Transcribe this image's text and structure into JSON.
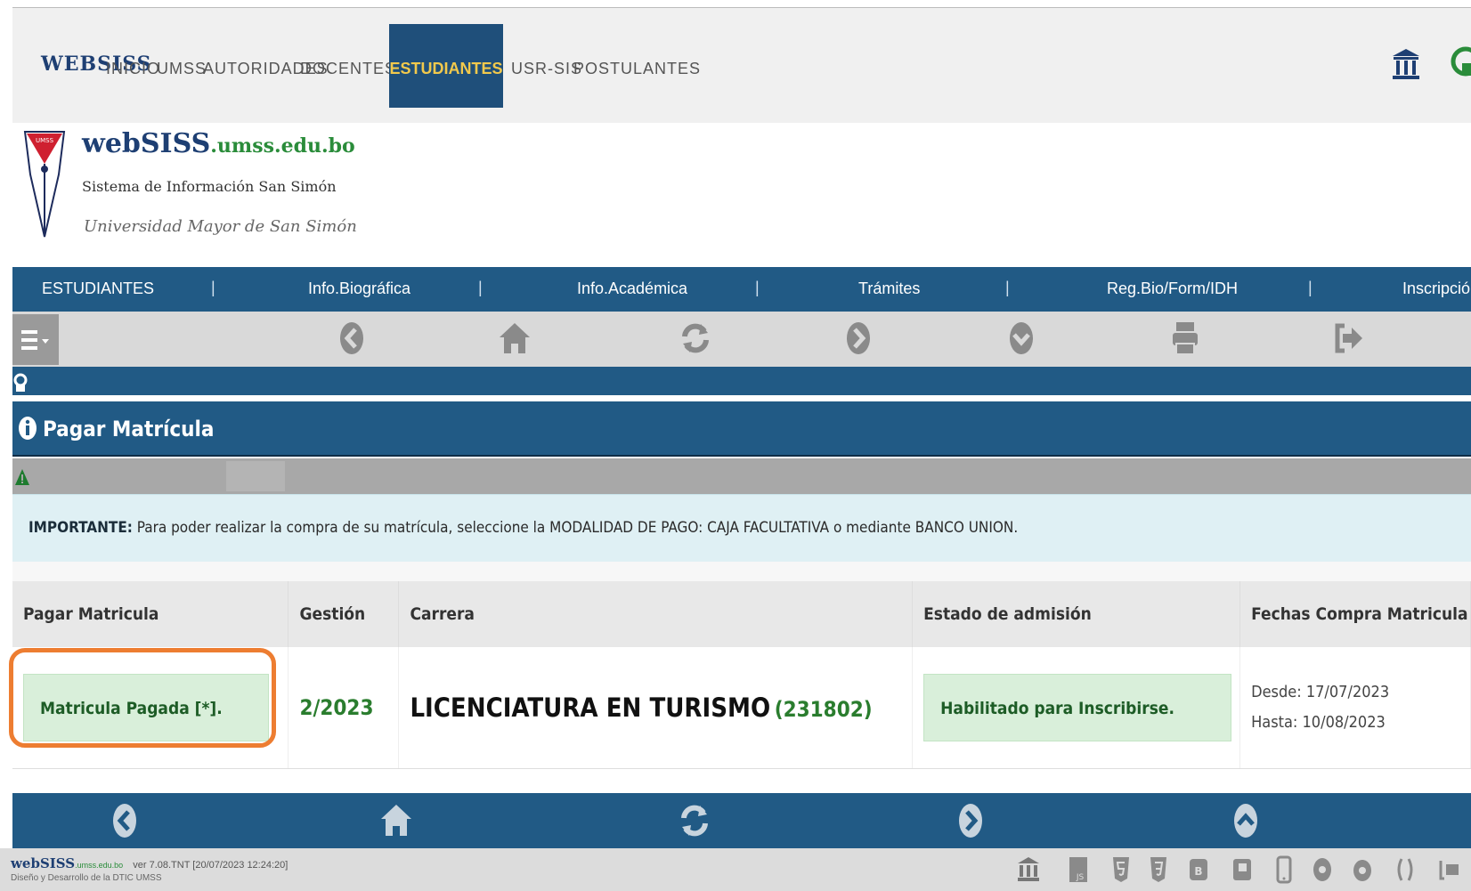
{
  "top_nav": {
    "brand": "WEBSISS",
    "tabs": [
      "INICIO",
      "UMSS",
      "AUTORIDADES",
      "DOCENTES",
      "ESTUDIANTES",
      "USR-SIS",
      "POSTULANTES"
    ],
    "active_tab": "ESTUDIANTES"
  },
  "banner": {
    "site_name": "webSISS",
    "site_domain": ".umss.edu.bo",
    "subtitle": "Sistema de Información San Simón",
    "university": "Universidad Mayor de San Simón",
    "shield_text": "UMSS"
  },
  "main_nav": {
    "items": [
      "ESTUDIANTES",
      "Info.Biográfica",
      "Info.Académica",
      "Trámites",
      "Reg.Bio/Form/IDH",
      "Inscripción"
    ],
    "separator": "|"
  },
  "toolbar": {
    "icons": [
      "menu-icon",
      "back-icon",
      "home-icon",
      "refresh-icon",
      "forward-icon",
      "down-icon",
      "print-icon",
      "logout-icon"
    ]
  },
  "section": {
    "title": "Pagar Matrícula"
  },
  "alert": {
    "label": "IMPORTANTE:",
    "text": " Para poder realizar la compra de su matrícula, seleccione la MODALIDAD DE PAGO: CAJA FACULTATIVA o mediante BANCO UNION."
  },
  "table": {
    "headers": [
      "Pagar Matricula",
      "Gestión",
      "Carrera",
      "Estado de admisión",
      "Fechas Compra Matricula"
    ],
    "row": {
      "pagar": "Matricula Pagada [*].",
      "gestion": "2/2023",
      "carrera": "LICENCIATURA EN TURISMO",
      "codigo": "(231802)",
      "estado": "Habilitado para Inscribirse.",
      "desde": "Desde: 17/07/2023",
      "hasta": "Hasta: 10/08/2023"
    }
  },
  "footer": {
    "brand": "webSISS",
    "domain": ".umss.edu.bo",
    "version": "ver 7.08.TNT [20/07/2023 12:24:20]",
    "credits": "Diseño y Desarrollo de la DTIC UMSS"
  },
  "colors": {
    "nav_blue": "#215a85",
    "active_tab_bg": "#1f4f7a",
    "active_tab_text": "#f2c94c",
    "success_green": "#d9efda",
    "highlight_orange": "#ed7d31"
  }
}
